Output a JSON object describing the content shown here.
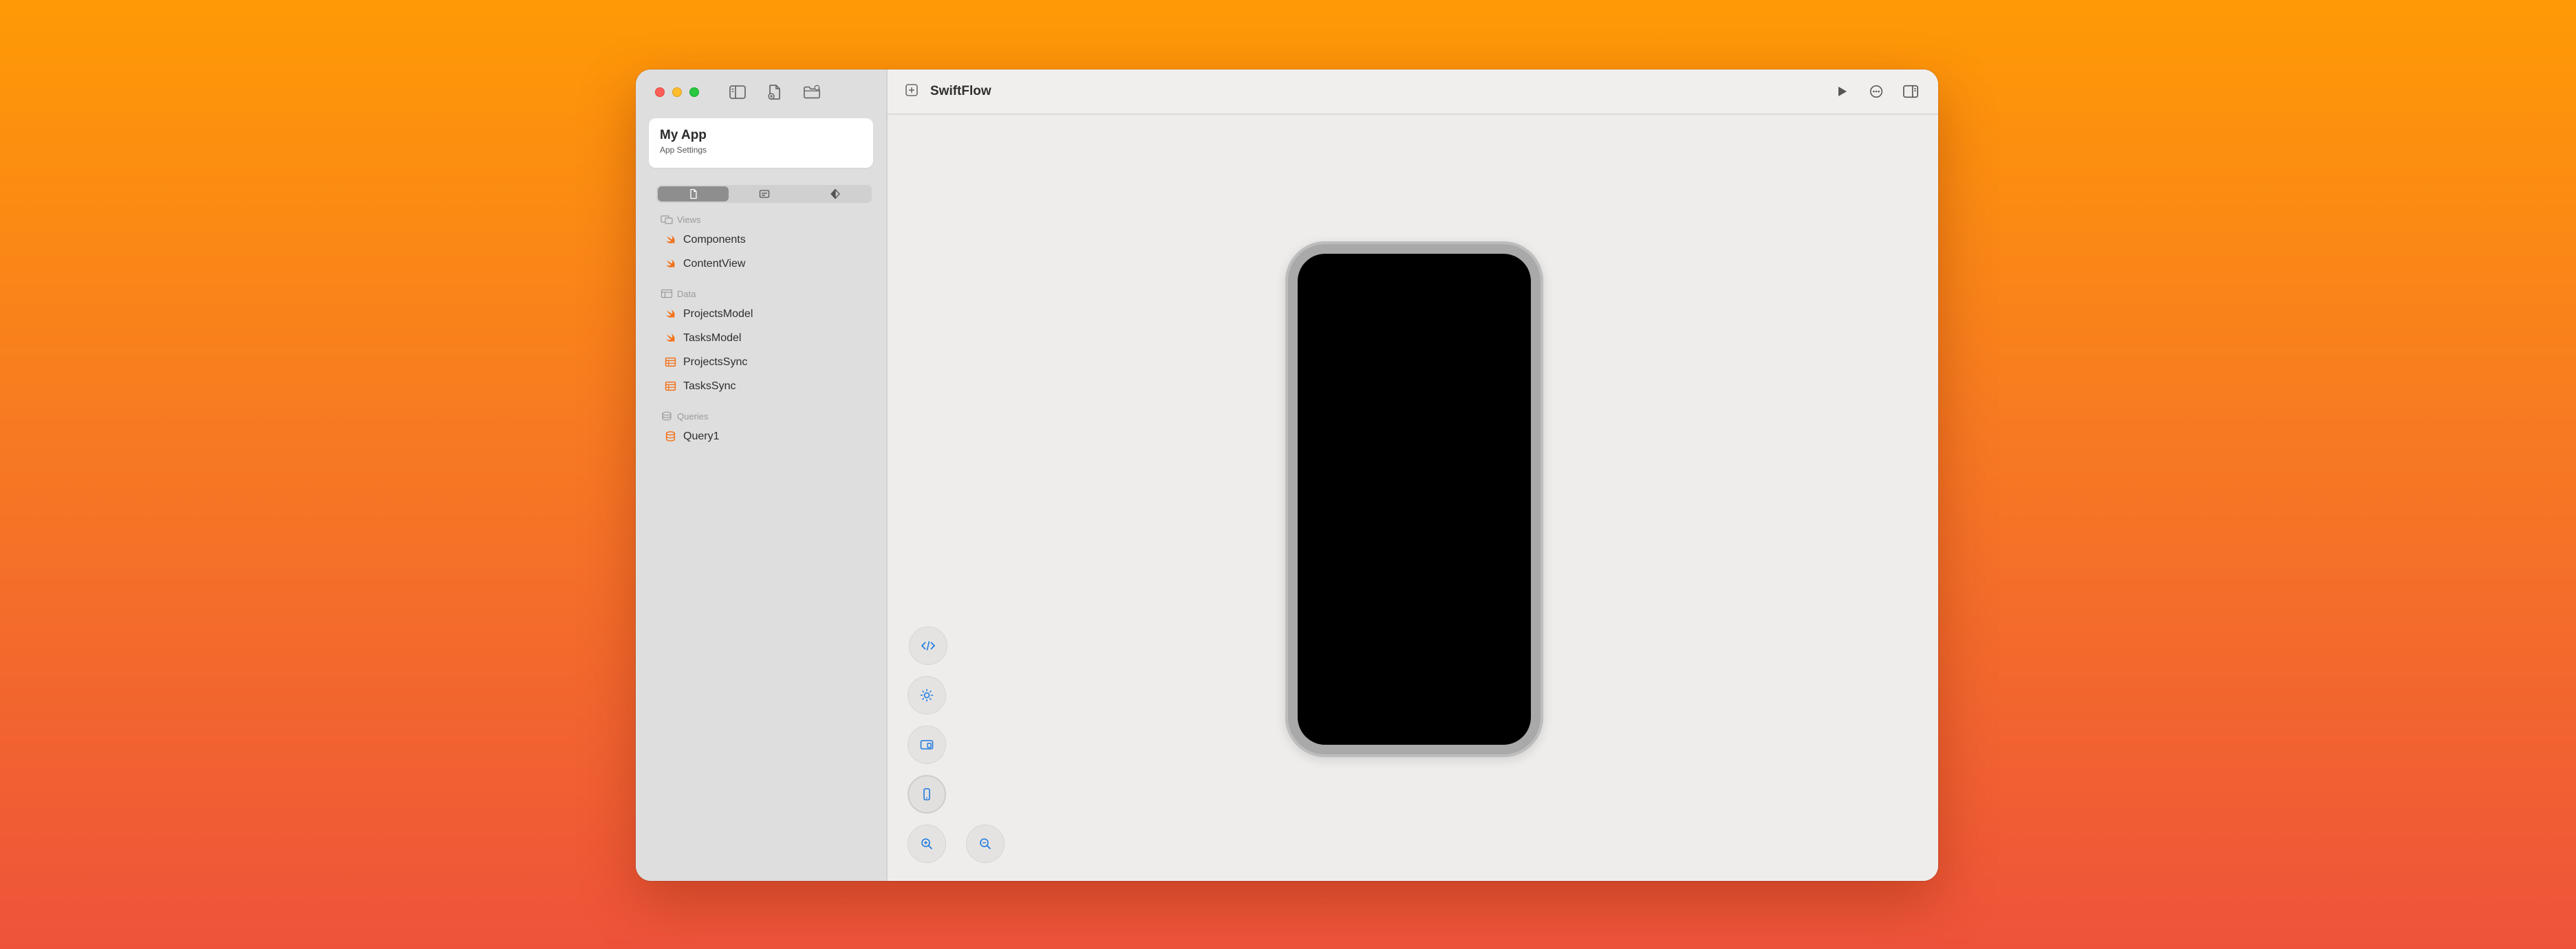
{
  "sidebar": {
    "app_title": "My App",
    "app_subtitle": "App Settings",
    "sections": [
      {
        "label": "Views",
        "items": [
          "Components",
          "ContentView"
        ]
      },
      {
        "label": "Data",
        "items": [
          "ProjectsModel",
          "TasksModel",
          "ProjectsSync",
          "TasksSync"
        ]
      },
      {
        "label": "Queries",
        "items": [
          "Query1"
        ]
      }
    ]
  },
  "toolbar": {
    "title": "SwiftFlow"
  },
  "colors": {
    "accent": "#1f7ae0",
    "swift_orange": "#f2721c",
    "background_top": "#ff9a05",
    "background_bottom": "#ee533a"
  },
  "icons": {
    "sidebar_toggle": "sidebar-toggle-icon",
    "new_file": "new-file-icon",
    "new_folder": "new-folder-icon",
    "play": "play-icon",
    "more": "ellipsis-circle-icon",
    "inspector": "inspector-toggle-icon",
    "code": "code-icon",
    "appearance": "sun-icon",
    "device_landscape": "device-landscape-icon",
    "device_portrait": "device-portrait-icon",
    "zoom_in": "zoom-in-icon",
    "zoom_out": "zoom-out-icon"
  }
}
